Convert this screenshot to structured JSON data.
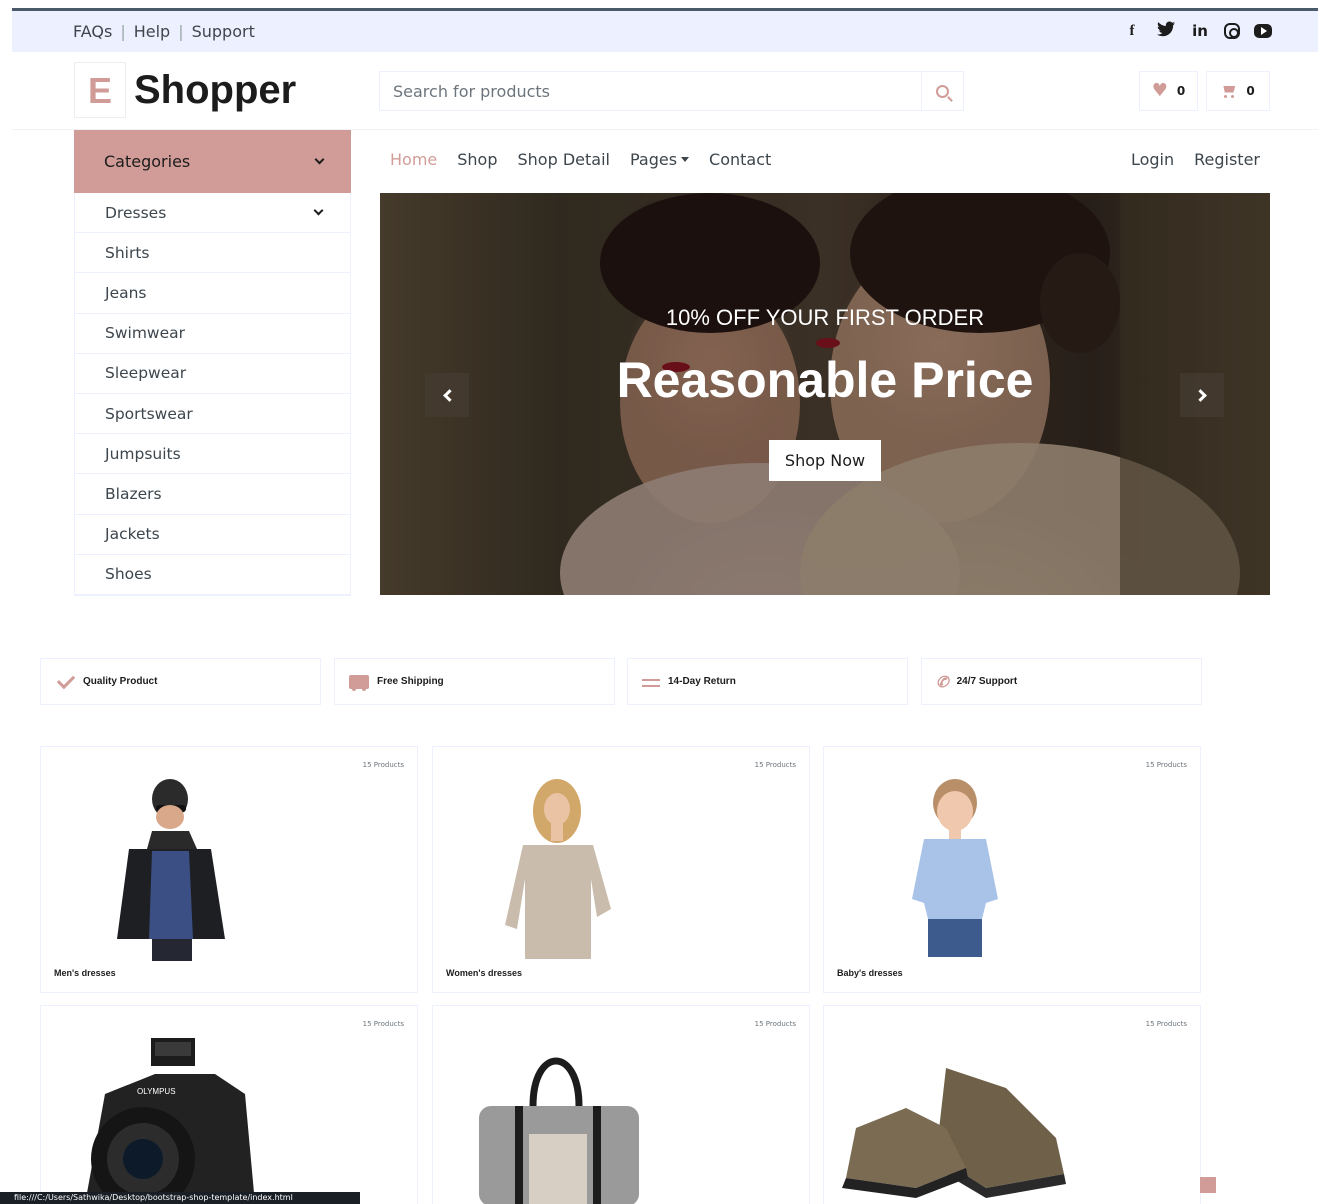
{
  "topbar": {
    "links": [
      "FAQs",
      "Help",
      "Support"
    ],
    "social": [
      "facebook-icon",
      "twitter-icon",
      "linkedin-icon",
      "instagram-icon",
      "youtube-icon"
    ]
  },
  "brand": {
    "letter": "E",
    "name": "Shopper"
  },
  "search": {
    "placeholder": "Search for products"
  },
  "wishlist": {
    "count": "0"
  },
  "cart": {
    "count": "0"
  },
  "categories": {
    "title": "Categories",
    "items": [
      "Dresses",
      "Shirts",
      "Jeans",
      "Swimwear",
      "Sleepwear",
      "Sportswear",
      "Jumpsuits",
      "Blazers",
      "Jackets",
      "Shoes"
    ]
  },
  "nav": {
    "items": [
      "Home",
      "Shop",
      "Shop Detail",
      "Pages",
      "Contact"
    ],
    "right": [
      "Login",
      "Register"
    ]
  },
  "hero": {
    "subtitle": "10% OFF YOUR FIRST ORDER",
    "title": "Reasonable Price",
    "button": "Shop Now"
  },
  "features": [
    "Quality Product",
    "Free Shipping",
    "14-Day Return",
    "24/7 Support"
  ],
  "cards": [
    {
      "label": "Men's dresses",
      "count": "15 Products"
    },
    {
      "label": "Women's dresses",
      "count": "15 Products"
    },
    {
      "label": "Baby's dresses",
      "count": "15 Products"
    },
    {
      "label": "",
      "count": "15 Products"
    },
    {
      "label": "",
      "count": "15 Products"
    },
    {
      "label": "",
      "count": "15 Products"
    }
  ],
  "camera_brand": "OLYMPUS",
  "statusbar": "file:///C:/Users/Sathwika/Desktop/bootstrap-shop-template/index.html",
  "colors": {
    "accent": "#d19c97",
    "topbar": "#edf1ff",
    "text": "#1c1c1c"
  }
}
